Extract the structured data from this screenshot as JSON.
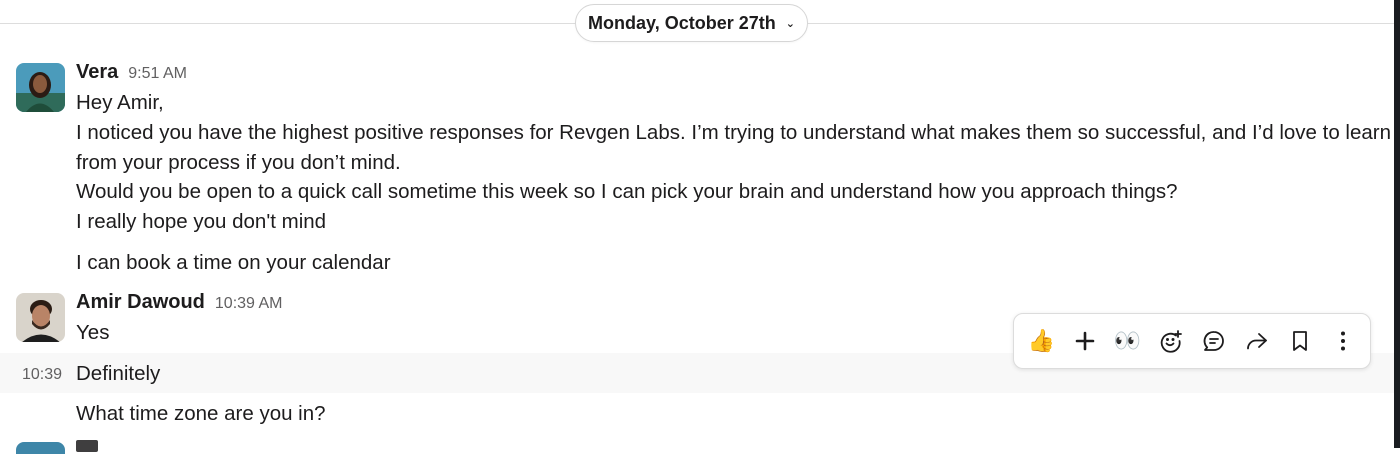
{
  "date_divider": {
    "label": "Monday, October 27th"
  },
  "messages": [
    {
      "sender": "Vera",
      "time": "9:51 AM",
      "lines": [
        "Hey Amir,",
        "I noticed you have the highest positive responses for Revgen Labs. I’m trying to understand what makes them so successful, and I’d love to learn",
        "from your process if you don’t mind.",
        "Would you be open to a quick call sometime this week so I can pick your brain and understand how you approach things?",
        "I really hope you don't mind"
      ],
      "followup": "I can book a time on your calendar"
    },
    {
      "sender": "Amir Dawoud",
      "time": "10:39 AM",
      "text": "Yes",
      "followups": [
        {
          "side_time": "10:39",
          "text": "Definitely"
        },
        {
          "text": "What time zone are you in?"
        }
      ]
    }
  ],
  "toolbar": {
    "actions": [
      {
        "name": "thumbs-up-reaction",
        "glyph": "👍"
      },
      {
        "name": "add-icon",
        "glyph": "+"
      },
      {
        "name": "eyes-reaction",
        "glyph": "👀"
      },
      {
        "name": "add-reaction-icon"
      },
      {
        "name": "reply-in-thread-icon"
      },
      {
        "name": "forward-icon"
      },
      {
        "name": "bookmark-icon"
      },
      {
        "name": "more-actions-icon"
      }
    ]
  },
  "colors": {
    "text": "#1d1c1d",
    "muted": "#616061",
    "hover_row": "#f8f8f8"
  }
}
